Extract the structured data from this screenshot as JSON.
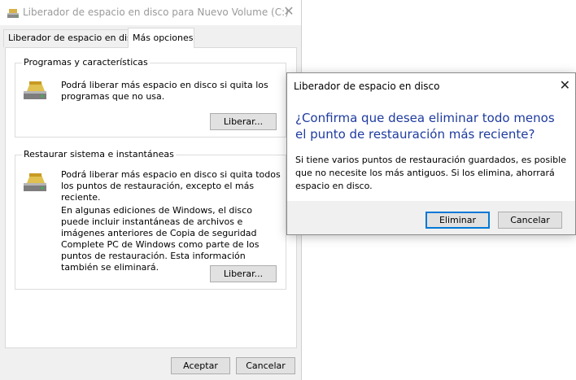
{
  "main_window": {
    "title": "Liberador de espacio en disco para Nuevo Volume (C:)",
    "close_glyph": "✕",
    "tabs": [
      {
        "label": "Liberador de espacio en disco",
        "active": false
      },
      {
        "label": "Más opciones",
        "active": true
      }
    ],
    "groups": {
      "programs": {
        "label": "Programas y características",
        "description": "Podrá liberar más espacio en disco si quita los programas que no usa.",
        "button": "Liberar..."
      },
      "restore": {
        "label": "Restaurar sistema e instantáneas",
        "description": "Podrá liberar más espacio en disco si quita todos los puntos de restauración, excepto el más reciente.",
        "note": "En algunas ediciones de Windows, el disco puede incluir instantáneas de archivos e imágenes anteriores de Copia de seguridad Complete PC de Windows como parte de los puntos de restauración. Esta información también se eliminará.",
        "button": "Liberar..."
      }
    },
    "footer": {
      "accept": "Aceptar",
      "cancel": "Cancelar"
    },
    "icon": "disk-cleanup-icon"
  },
  "dialog": {
    "title": "Liberador de espacio en disco",
    "close_glyph": "✕",
    "main_instruction": "¿Confirma que desea eliminar todo menos el punto de restauración más reciente?",
    "content": "Si tiene varios puntos de restauración guardados, es posible que no necesite los más antiguos. Si los elimina, ahorrará espacio en disco.",
    "buttons": {
      "delete": "Eliminar",
      "cancel": "Cancelar"
    },
    "accent_color": "#1e3b9f",
    "default_button_border": "#0078d7"
  }
}
